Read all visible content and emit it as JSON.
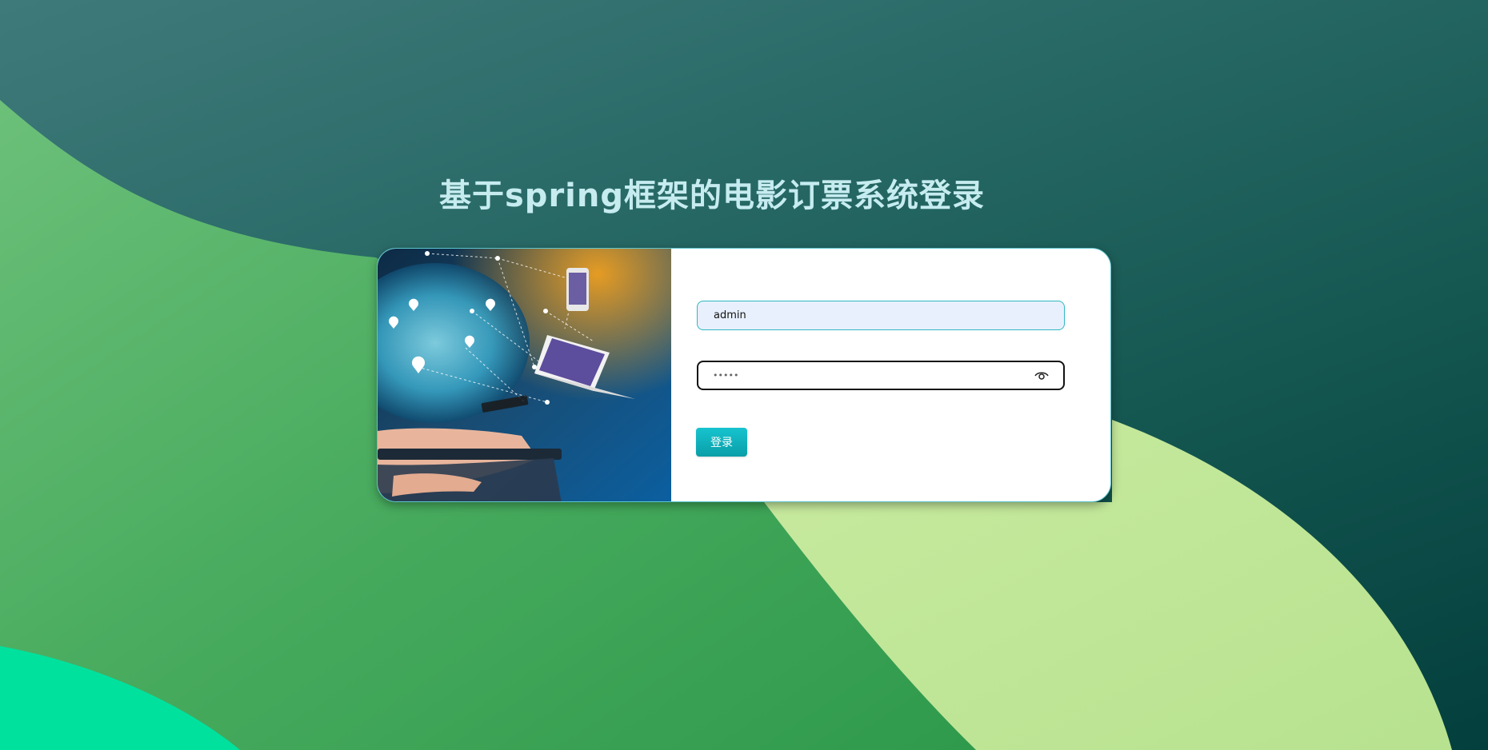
{
  "page": {
    "title": "基于spring框架的电影订票系统登录"
  },
  "login": {
    "username_value": "admin",
    "password_masked": "•••••",
    "login_label": "登录"
  },
  "icons": {
    "password_toggle": "eye-icon"
  },
  "colors": {
    "title": "#c6ecf0",
    "button": "#16c4cf",
    "input_focus_border": "#2fb8c1"
  }
}
